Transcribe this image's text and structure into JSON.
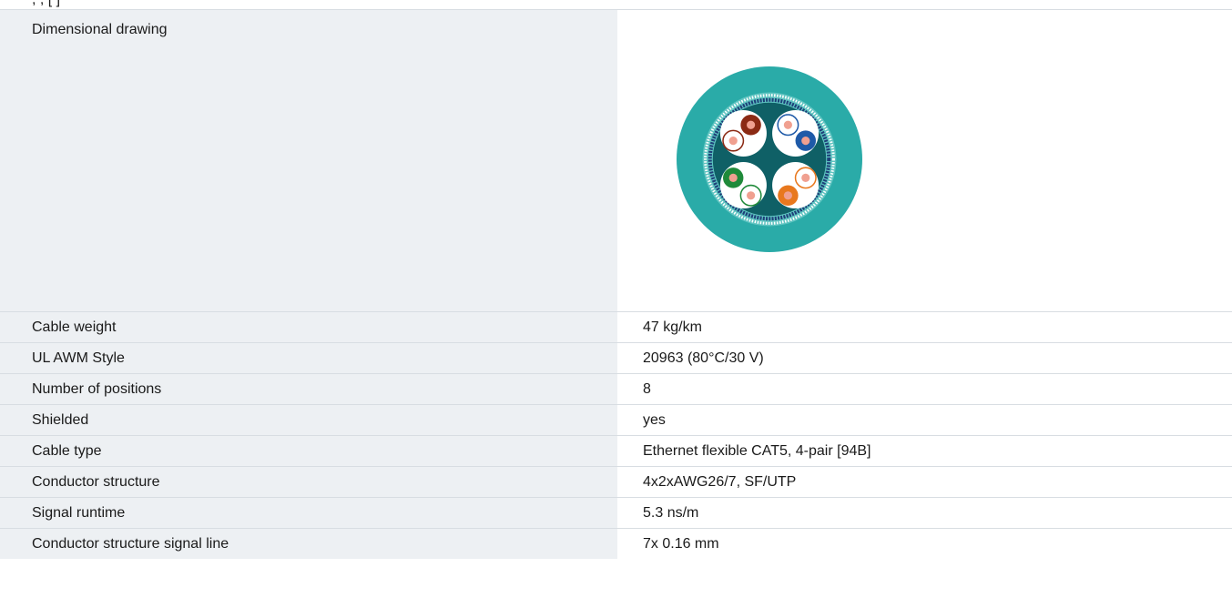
{
  "top_clipped_text": "                       ,   ,    [   ]",
  "dimensional_drawing": {
    "label": "Dimensional drawing",
    "image": "cable-cross-section-icon"
  },
  "rows": [
    {
      "label": "Cable weight",
      "value": "47 kg/km"
    },
    {
      "label": "UL AWM Style",
      "value": "20963 (80°C/30 V)"
    },
    {
      "label": "Number of positions",
      "value": "8"
    },
    {
      "label": "Shielded",
      "value": "yes"
    },
    {
      "label": "Cable type",
      "value": "Ethernet flexible CAT5, 4-pair [94B]"
    },
    {
      "label": "Conductor structure",
      "value": "4x2xAWG26/7, SF/UTP"
    },
    {
      "label": "Signal runtime",
      "value": "5.3 ns/m"
    },
    {
      "label": "Conductor structure signal line",
      "value": "7x 0.16 mm"
    }
  ],
  "colors": {
    "label_bg": "#edf0f3",
    "border": "#d8dde2",
    "jacket": "#2aaba8",
    "inner": "#0f6066"
  }
}
